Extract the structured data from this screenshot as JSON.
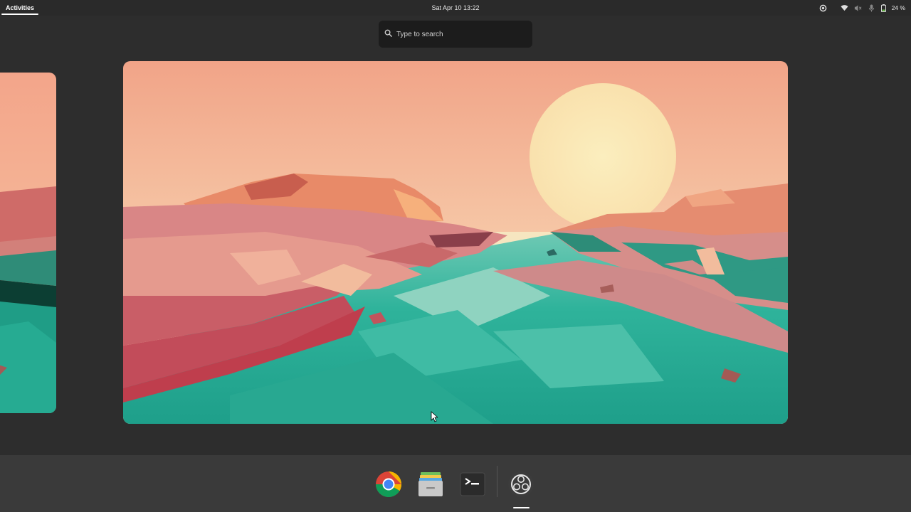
{
  "topbar": {
    "activities_label": "Activities",
    "clock": "Sat Apr 10  13:22",
    "battery_percent": "24 %",
    "icons": [
      "screenshot-recording-icon",
      "wifi-icon",
      "speaker-muted-icon",
      "microphone-icon",
      "battery-icon"
    ]
  },
  "search": {
    "placeholder": "Type to search",
    "icon": "search-icon"
  },
  "workspaces": {
    "count": 2,
    "active_index": 1,
    "wallpaper": "low-poly-river-sunset"
  },
  "dock": {
    "apps": [
      {
        "name": "Google Chrome",
        "icon": "chrome-icon",
        "running": false
      },
      {
        "name": "Files",
        "icon": "files-icon",
        "running": false
      },
      {
        "name": "Terminal",
        "icon": "terminal-icon",
        "running": false
      },
      {
        "name": "OBS Studio",
        "icon": "obs-icon",
        "running": true
      }
    ]
  },
  "colors": {
    "panel": "#2a2a2a",
    "background": "#2d2d2d",
    "dock": "#3a3a3a",
    "search_bg": "#1c1c1c"
  }
}
